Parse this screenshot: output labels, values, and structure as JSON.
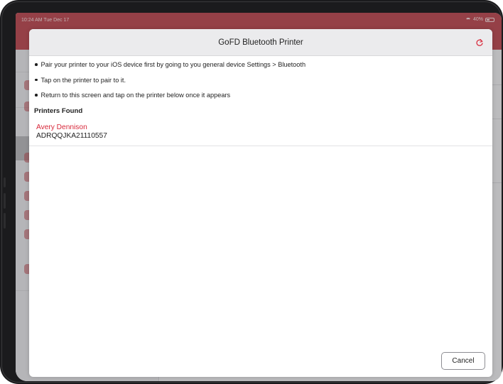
{
  "status_bar": {
    "time": "10:24 AM  Tue Dec 17",
    "battery": "40%",
    "icons": [
      "wifi-icon",
      "battery-icon"
    ]
  },
  "colors": {
    "header_red": "#b8424a",
    "printer_name_red": "#d8283a"
  },
  "modal": {
    "title": "GoFD Bluetooth Printer",
    "refresh_icon": "refresh-icon",
    "instructions": [
      "Pair your printer to your iOS device first by going to you general device Settings > Bluetooth",
      "Tap on the printer to pair to it.",
      "Return to this screen and tap on the printer below once it appears"
    ],
    "printers_heading": "Printers Found",
    "printers": [
      {
        "name": "Avery Dennison",
        "id": "ADRQQJKA21110557"
      }
    ],
    "cancel_label": "Cancel"
  }
}
